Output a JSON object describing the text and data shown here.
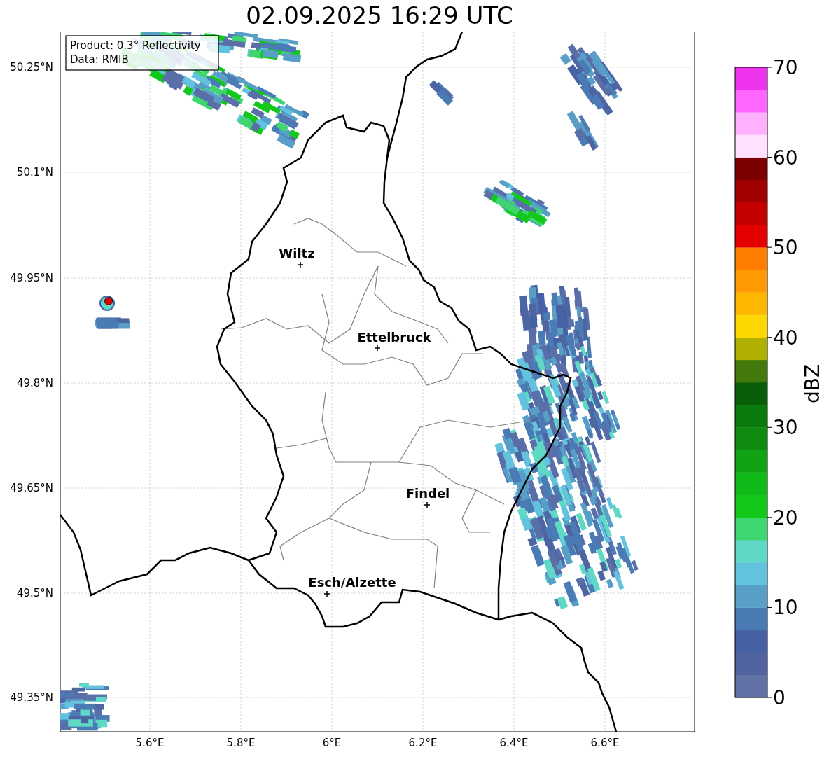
{
  "title": "02.09.2025 16:29 UTC",
  "info_box": {
    "lines": [
      "Product: 0.3° Reflectivity",
      "Data: RMIB"
    ]
  },
  "map": {
    "latitude_labels": [
      "50.25°N",
      "50.1°N",
      "49.95°N",
      "49.8°N",
      "49.65°N",
      "49.5°N",
      "49.35°N"
    ],
    "longitude_labels": [
      "5.6°E",
      "5.8°E",
      "6°E",
      "6.2°E",
      "6.4°E",
      "6.6°E"
    ],
    "cities": [
      {
        "name": "Wiltz"
      },
      {
        "name": "Ettelbruck"
      },
      {
        "name": "Findel"
      },
      {
        "name": "Esch/Alzette"
      }
    ]
  },
  "colorbar": {
    "label": "dBZ",
    "ticks": [
      "70",
      "60",
      "50",
      "40",
      "30",
      "20",
      "10",
      "0"
    ],
    "bins": [
      {
        "color": "#6272a6"
      },
      {
        "color": "#5264a0"
      },
      {
        "color": "#4662a5"
      },
      {
        "color": "#4a7bb5"
      },
      {
        "color": "#579fc7"
      },
      {
        "color": "#63c2de"
      },
      {
        "color": "#5fd9c5"
      },
      {
        "color": "#3ed670"
      },
      {
        "color": "#12c91a"
      },
      {
        "color": "#10ba18"
      },
      {
        "color": "#10a313"
      },
      {
        "color": "#0f8c10"
      },
      {
        "color": "#0b7a0c"
      },
      {
        "color": "#095e0a"
      },
      {
        "color": "#447a0d"
      },
      {
        "color": "#b0b000"
      },
      {
        "color": "#ffd700"
      },
      {
        "color": "#ffb800"
      },
      {
        "color": "#ff9a00"
      },
      {
        "color": "#ff7e00"
      },
      {
        "color": "#e50000"
      },
      {
        "color": "#c50000"
      },
      {
        "color": "#a00000"
      },
      {
        "color": "#7d0000"
      },
      {
        "color": "#ffe0ff"
      },
      {
        "color": "#ffb0ff"
      },
      {
        "color": "#ff66ff"
      },
      {
        "color": "#ee33ee"
      }
    ]
  }
}
